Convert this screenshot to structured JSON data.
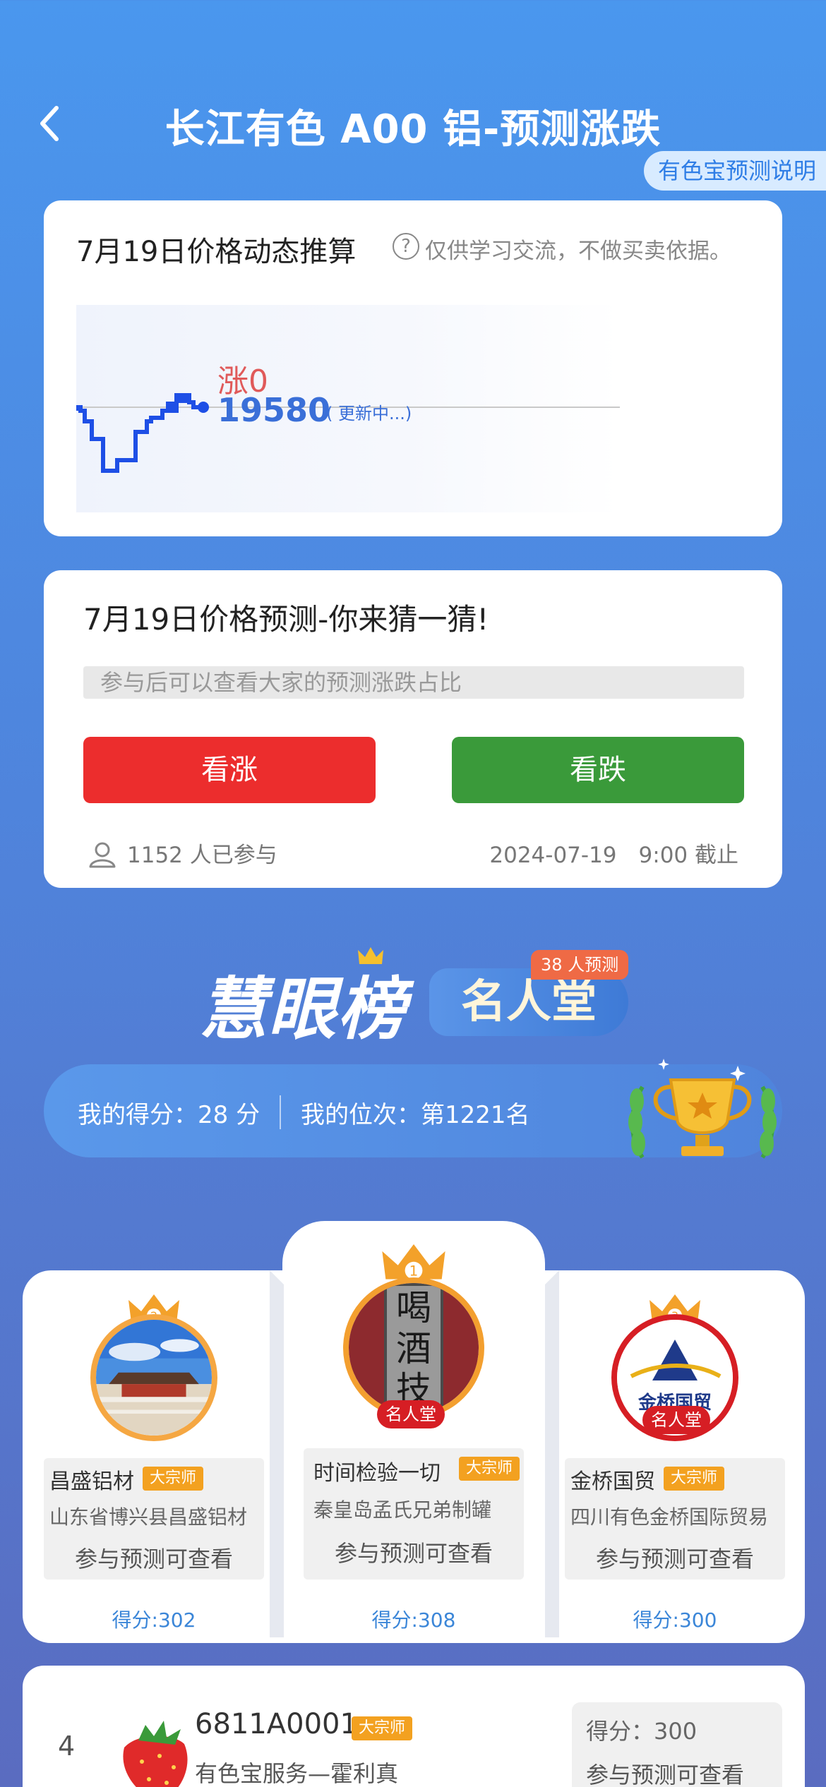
{
  "header": {
    "title": "长江有色 A00 铝-预测涨跌",
    "explain_link": "有色宝预测说明"
  },
  "dynamic_card": {
    "title": "7月19日价格动态推算",
    "help_icon": "question-circle-icon",
    "note": "仅供学习交流，不做买卖依据。",
    "change_label": "涨0",
    "price": "19580",
    "status": "( 更新中...)",
    "line_color": "#1e4fe6"
  },
  "predict_card": {
    "title": "7月19日价格预测-你来猜一猜!",
    "hint": "参与后可以查看大家的预测涨跌占比",
    "up_label": "看涨",
    "down_label": "看跌",
    "participants": "1152 人已参与",
    "deadline": "2024-07-19　9:00 截止"
  },
  "banner": {
    "title": "慧眼榜",
    "hall": "名人堂",
    "badge": "38 人预测"
  },
  "my_stats": {
    "score": "我的得分：28 分",
    "rank": "我的位次：第1221名"
  },
  "podium": [
    {
      "rank": "2",
      "name": "昌盛铝材",
      "tag": "大宗师",
      "company": "山东省博兴县昌盛铝材",
      "cta": "参与预测可查看",
      "score": "得分:302",
      "hall_tag": ""
    },
    {
      "rank": "1",
      "name": "时间检验一切",
      "tag": "大宗师",
      "company": "秦皇岛孟氏兄弟制罐",
      "cta": "参与预测可查看",
      "score": "得分:308",
      "hall_tag": "名人堂",
      "avatar_text": [
        "喝",
        "酒",
        "技"
      ]
    },
    {
      "rank": "3",
      "name": "金桥国贸",
      "tag": "大宗师",
      "company": "四川有色金桥国际贸易",
      "cta": "参与预测可查看",
      "score": "得分:300",
      "hall_tag": "名人堂",
      "avatar_text": [
        "金桥国贸"
      ]
    }
  ],
  "list": [
    {
      "rank": "4",
      "name": "6811A0001",
      "tag": "大宗师",
      "company": "有色宝服务—霍利真",
      "score": "得分：300",
      "cta": "参与预测可查看"
    }
  ]
}
